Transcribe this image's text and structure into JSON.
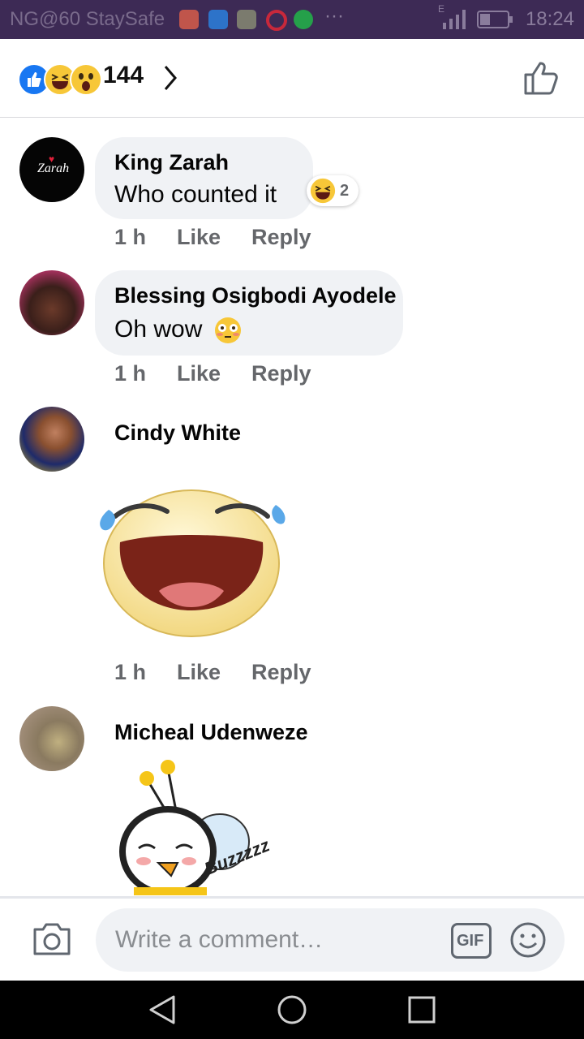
{
  "status_bar": {
    "carrier": "NG@60 StaySafe",
    "time": "18:24",
    "signal_letter": "E"
  },
  "reactions": {
    "types": [
      "like-icon",
      "haha-icon",
      "wow-icon"
    ],
    "count": "144"
  },
  "comments": [
    {
      "name": "King Zarah",
      "avatar_text": "Zarah",
      "text": "Who counted it",
      "reaction_count": "2",
      "time": "1 h",
      "like": "Like",
      "reply": "Reply"
    },
    {
      "name": "Blessing Osigbodi Ayodele",
      "text": "Oh wow",
      "emoji": "😳",
      "time": "1 h",
      "like": "Like",
      "reply": "Reply"
    },
    {
      "name": "Cindy White",
      "sticker": "laughing-tears-sticker",
      "time": "1 h",
      "like": "Like",
      "reply": "Reply"
    },
    {
      "name": "Micheal Udenweze",
      "sticker": "sleeping-bee-sticker",
      "sticker_text": "Buzzzzz"
    }
  ],
  "composer": {
    "placeholder": "Write a comment…",
    "gif_label": "GIF"
  },
  "colors": {
    "status_bar": "#3d2a55",
    "bubble": "#f0f2f5",
    "meta_text": "#65676b",
    "like_blue": "#1877f2",
    "haha_yellow": "#f7c738"
  }
}
